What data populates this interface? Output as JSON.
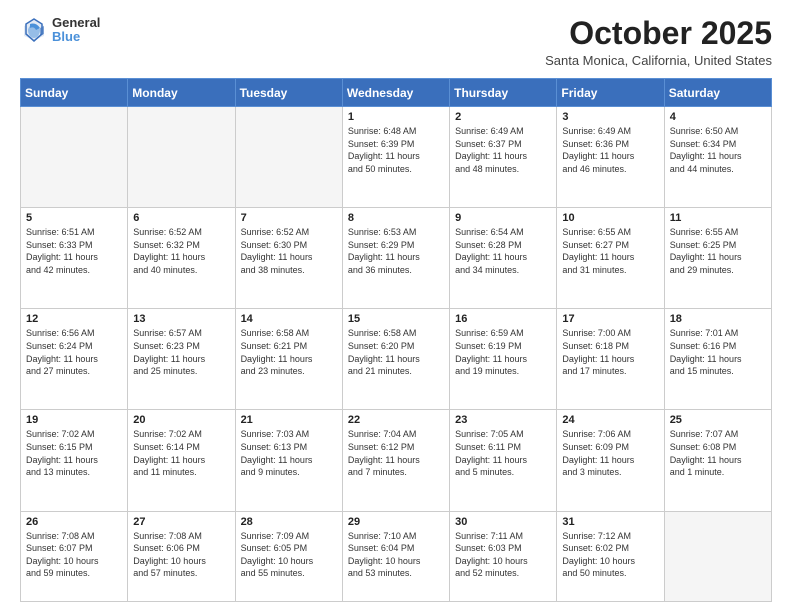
{
  "header": {
    "logo": {
      "line1": "General",
      "line2": "Blue"
    },
    "title": "October 2025",
    "location": "Santa Monica, California, United States"
  },
  "weekdays": [
    "Sunday",
    "Monday",
    "Tuesday",
    "Wednesday",
    "Thursday",
    "Friday",
    "Saturday"
  ],
  "weeks": [
    [
      {
        "day": "",
        "info": ""
      },
      {
        "day": "",
        "info": ""
      },
      {
        "day": "",
        "info": ""
      },
      {
        "day": "1",
        "info": "Sunrise: 6:48 AM\nSunset: 6:39 PM\nDaylight: 11 hours\nand 50 minutes."
      },
      {
        "day": "2",
        "info": "Sunrise: 6:49 AM\nSunset: 6:37 PM\nDaylight: 11 hours\nand 48 minutes."
      },
      {
        "day": "3",
        "info": "Sunrise: 6:49 AM\nSunset: 6:36 PM\nDaylight: 11 hours\nand 46 minutes."
      },
      {
        "day": "4",
        "info": "Sunrise: 6:50 AM\nSunset: 6:34 PM\nDaylight: 11 hours\nand 44 minutes."
      }
    ],
    [
      {
        "day": "5",
        "info": "Sunrise: 6:51 AM\nSunset: 6:33 PM\nDaylight: 11 hours\nand 42 minutes."
      },
      {
        "day": "6",
        "info": "Sunrise: 6:52 AM\nSunset: 6:32 PM\nDaylight: 11 hours\nand 40 minutes."
      },
      {
        "day": "7",
        "info": "Sunrise: 6:52 AM\nSunset: 6:30 PM\nDaylight: 11 hours\nand 38 minutes."
      },
      {
        "day": "8",
        "info": "Sunrise: 6:53 AM\nSunset: 6:29 PM\nDaylight: 11 hours\nand 36 minutes."
      },
      {
        "day": "9",
        "info": "Sunrise: 6:54 AM\nSunset: 6:28 PM\nDaylight: 11 hours\nand 34 minutes."
      },
      {
        "day": "10",
        "info": "Sunrise: 6:55 AM\nSunset: 6:27 PM\nDaylight: 11 hours\nand 31 minutes."
      },
      {
        "day": "11",
        "info": "Sunrise: 6:55 AM\nSunset: 6:25 PM\nDaylight: 11 hours\nand 29 minutes."
      }
    ],
    [
      {
        "day": "12",
        "info": "Sunrise: 6:56 AM\nSunset: 6:24 PM\nDaylight: 11 hours\nand 27 minutes."
      },
      {
        "day": "13",
        "info": "Sunrise: 6:57 AM\nSunset: 6:23 PM\nDaylight: 11 hours\nand 25 minutes."
      },
      {
        "day": "14",
        "info": "Sunrise: 6:58 AM\nSunset: 6:21 PM\nDaylight: 11 hours\nand 23 minutes."
      },
      {
        "day": "15",
        "info": "Sunrise: 6:58 AM\nSunset: 6:20 PM\nDaylight: 11 hours\nand 21 minutes."
      },
      {
        "day": "16",
        "info": "Sunrise: 6:59 AM\nSunset: 6:19 PM\nDaylight: 11 hours\nand 19 minutes."
      },
      {
        "day": "17",
        "info": "Sunrise: 7:00 AM\nSunset: 6:18 PM\nDaylight: 11 hours\nand 17 minutes."
      },
      {
        "day": "18",
        "info": "Sunrise: 7:01 AM\nSunset: 6:16 PM\nDaylight: 11 hours\nand 15 minutes."
      }
    ],
    [
      {
        "day": "19",
        "info": "Sunrise: 7:02 AM\nSunset: 6:15 PM\nDaylight: 11 hours\nand 13 minutes."
      },
      {
        "day": "20",
        "info": "Sunrise: 7:02 AM\nSunset: 6:14 PM\nDaylight: 11 hours\nand 11 minutes."
      },
      {
        "day": "21",
        "info": "Sunrise: 7:03 AM\nSunset: 6:13 PM\nDaylight: 11 hours\nand 9 minutes."
      },
      {
        "day": "22",
        "info": "Sunrise: 7:04 AM\nSunset: 6:12 PM\nDaylight: 11 hours\nand 7 minutes."
      },
      {
        "day": "23",
        "info": "Sunrise: 7:05 AM\nSunset: 6:11 PM\nDaylight: 11 hours\nand 5 minutes."
      },
      {
        "day": "24",
        "info": "Sunrise: 7:06 AM\nSunset: 6:09 PM\nDaylight: 11 hours\nand 3 minutes."
      },
      {
        "day": "25",
        "info": "Sunrise: 7:07 AM\nSunset: 6:08 PM\nDaylight: 11 hours\nand 1 minute."
      }
    ],
    [
      {
        "day": "26",
        "info": "Sunrise: 7:08 AM\nSunset: 6:07 PM\nDaylight: 10 hours\nand 59 minutes."
      },
      {
        "day": "27",
        "info": "Sunrise: 7:08 AM\nSunset: 6:06 PM\nDaylight: 10 hours\nand 57 minutes."
      },
      {
        "day": "28",
        "info": "Sunrise: 7:09 AM\nSunset: 6:05 PM\nDaylight: 10 hours\nand 55 minutes."
      },
      {
        "day": "29",
        "info": "Sunrise: 7:10 AM\nSunset: 6:04 PM\nDaylight: 10 hours\nand 53 minutes."
      },
      {
        "day": "30",
        "info": "Sunrise: 7:11 AM\nSunset: 6:03 PM\nDaylight: 10 hours\nand 52 minutes."
      },
      {
        "day": "31",
        "info": "Sunrise: 7:12 AM\nSunset: 6:02 PM\nDaylight: 10 hours\nand 50 minutes."
      },
      {
        "day": "",
        "info": ""
      }
    ]
  ]
}
